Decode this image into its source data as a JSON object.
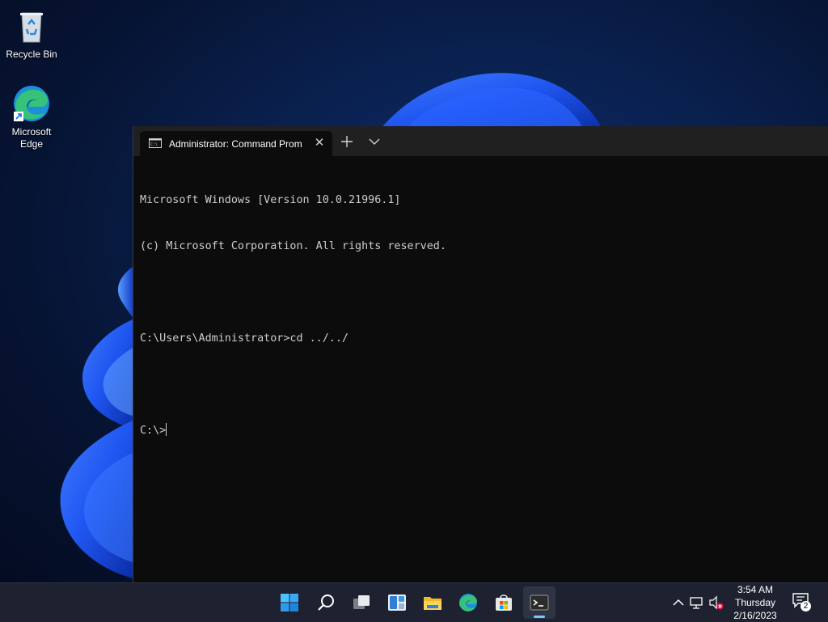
{
  "desktop": {
    "icons": [
      {
        "label": "Recycle Bin",
        "icon": "recycle-bin-icon"
      },
      {
        "label": "Microsoft\nEdge",
        "icon": "edge-icon"
      }
    ]
  },
  "terminal": {
    "tab": {
      "title": "Administrator: Command Prom",
      "icon": "cmd-icon",
      "close": "✕"
    },
    "new_tab_icon": "plus-icon",
    "dropdown_icon": "chevron-down-icon",
    "lines": [
      "Microsoft Windows [Version 10.0.21996.1]",
      "(c) Microsoft Corporation. All rights reserved.",
      "",
      "C:\\Users\\Administrator>cd ../../",
      "",
      "C:\\>"
    ],
    "colors": {
      "background": "#0c0c0c",
      "text": "#cccccc",
      "tabbar": "#202020"
    }
  },
  "taskbar": {
    "apps": [
      {
        "name": "start",
        "icon": "windows-start-icon"
      },
      {
        "name": "search",
        "icon": "search-icon"
      },
      {
        "name": "task-view",
        "icon": "task-view-icon"
      },
      {
        "name": "widgets",
        "icon": "widgets-icon"
      },
      {
        "name": "file-explorer",
        "icon": "folder-icon"
      },
      {
        "name": "edge",
        "icon": "edge-icon"
      },
      {
        "name": "store",
        "icon": "store-icon"
      },
      {
        "name": "terminal",
        "icon": "terminal-icon",
        "active": true
      }
    ],
    "tray": {
      "icons": [
        "chevron-up-icon",
        "network-icon",
        "volume-muted-icon"
      ],
      "time": "3:54 AM",
      "day": "Thursday",
      "date": "2/16/2023",
      "notification_count": "2"
    },
    "colors": {
      "background": "#1e2230",
      "accent": "#7ec6ff"
    }
  }
}
